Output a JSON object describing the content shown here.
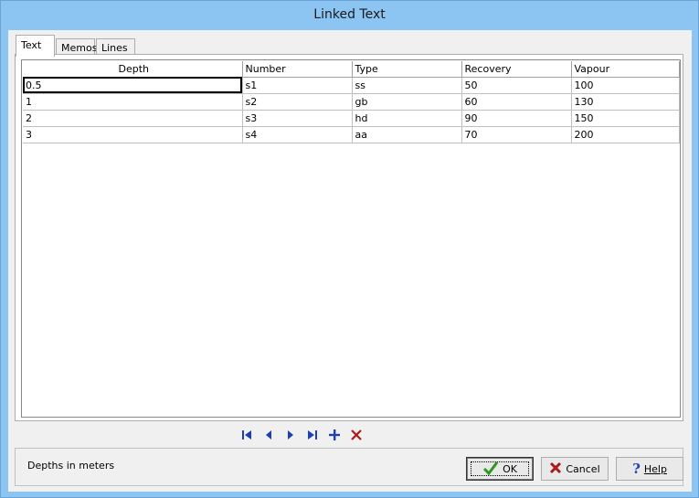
{
  "window": {
    "title": "Linked Text"
  },
  "tabs": [
    {
      "label": "Text",
      "active": true
    },
    {
      "label": "Memos",
      "active": false
    },
    {
      "label": "Lines",
      "active": false
    }
  ],
  "grid": {
    "columns": [
      "Depth",
      "Number",
      "Type",
      "Recovery",
      "Vapour"
    ],
    "rows": [
      [
        "0.5",
        "s1",
        "ss",
        "50",
        "100"
      ],
      [
        "1",
        "s2",
        "gb",
        "60",
        "130"
      ],
      [
        "2",
        "s3",
        "hd",
        "90",
        "150"
      ],
      [
        "3",
        "s4",
        "aa",
        "70",
        "200"
      ]
    ]
  },
  "navigator": {
    "icons": [
      "first-record-icon",
      "prior-record-icon",
      "next-record-icon",
      "last-record-icon",
      "insert-record-icon",
      "delete-record-icon"
    ]
  },
  "footer": {
    "info": "Depths in meters",
    "ok_label": "OK",
    "cancel_label": "Cancel",
    "help_label": "Help"
  },
  "colors": {
    "nav_blue": "#1e3fb4",
    "delete_red": "#b01818",
    "check_green": "#2b9a1e",
    "window_frame": "#8cc4f2"
  }
}
